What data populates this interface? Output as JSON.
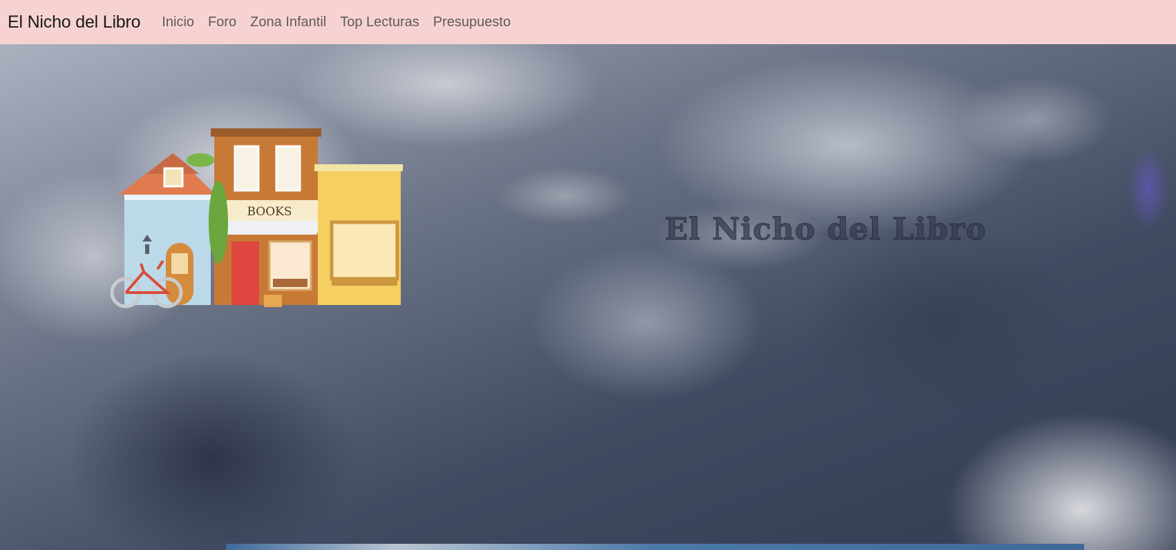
{
  "navbar": {
    "brand": "El Nicho del Libro",
    "links": [
      {
        "label": "Inicio"
      },
      {
        "label": "Foro"
      },
      {
        "label": "Zona Infantil"
      },
      {
        "label": "Top Lecturas"
      },
      {
        "label": "Presupuesto"
      }
    ]
  },
  "hero": {
    "title": "El Nicho del Libro",
    "store_sign": "BOOKS"
  },
  "colors": {
    "navbar_bg": "#f6d3d2",
    "brand_text": "#1a1a1a",
    "nav_link_text": "#5f5a5a"
  }
}
